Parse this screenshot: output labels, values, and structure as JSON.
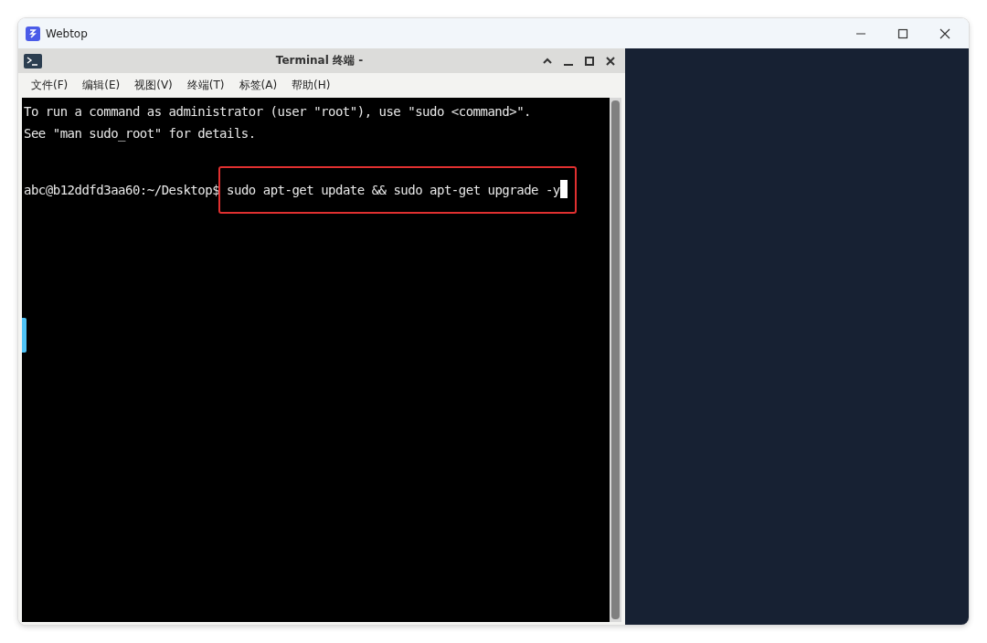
{
  "window": {
    "title": "Webtop"
  },
  "terminal": {
    "title": "Terminal 终端 -",
    "menu": [
      "文件(F)",
      "编辑(E)",
      "视图(V)",
      "终端(T)",
      "标签(A)",
      "帮助(H)"
    ],
    "lines": [
      {
        "kind": "output",
        "text": "To run a command as administrator (user \"root\"), use \"sudo <command>\"."
      },
      {
        "kind": "output",
        "text": "See \"man sudo_root\" for details."
      },
      {
        "kind": "blank"
      },
      {
        "kind": "prompt",
        "prompt": "abc@b12ddfd3aa60:~/Desktop$",
        "command": "sudo apt-get update && sudo apt-get upgrade -y",
        "highlighted": true
      }
    ]
  }
}
